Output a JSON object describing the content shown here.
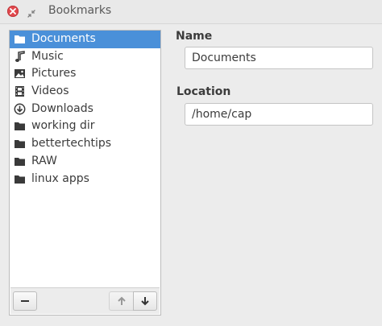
{
  "window": {
    "title": "Bookmarks",
    "close_icon": "close-icon",
    "restore_icon": "restore-icon"
  },
  "bookmarks": {
    "selected_index": 0,
    "items": [
      {
        "label": "Documents",
        "icon": "folder-icon"
      },
      {
        "label": "Music",
        "icon": "music-icon"
      },
      {
        "label": "Pictures",
        "icon": "pictures-icon"
      },
      {
        "label": "Videos",
        "icon": "videos-icon"
      },
      {
        "label": "Downloads",
        "icon": "download-icon"
      },
      {
        "label": "working dir",
        "icon": "folder-icon"
      },
      {
        "label": "bettertechtips",
        "icon": "folder-icon"
      },
      {
        "label": "RAW",
        "icon": "folder-icon"
      },
      {
        "label": "linux apps",
        "icon": "folder-icon"
      }
    ],
    "toolbar": {
      "remove_icon": "minus-icon",
      "move_up_icon": "arrow-up-icon",
      "move_down_icon": "arrow-down-icon"
    }
  },
  "details": {
    "name_label": "Name",
    "name_value": "Documents",
    "location_label": "Location",
    "location_value": "/home/cap"
  },
  "colors": {
    "selection": "#4a90d9",
    "close_button": "#e2484d"
  }
}
